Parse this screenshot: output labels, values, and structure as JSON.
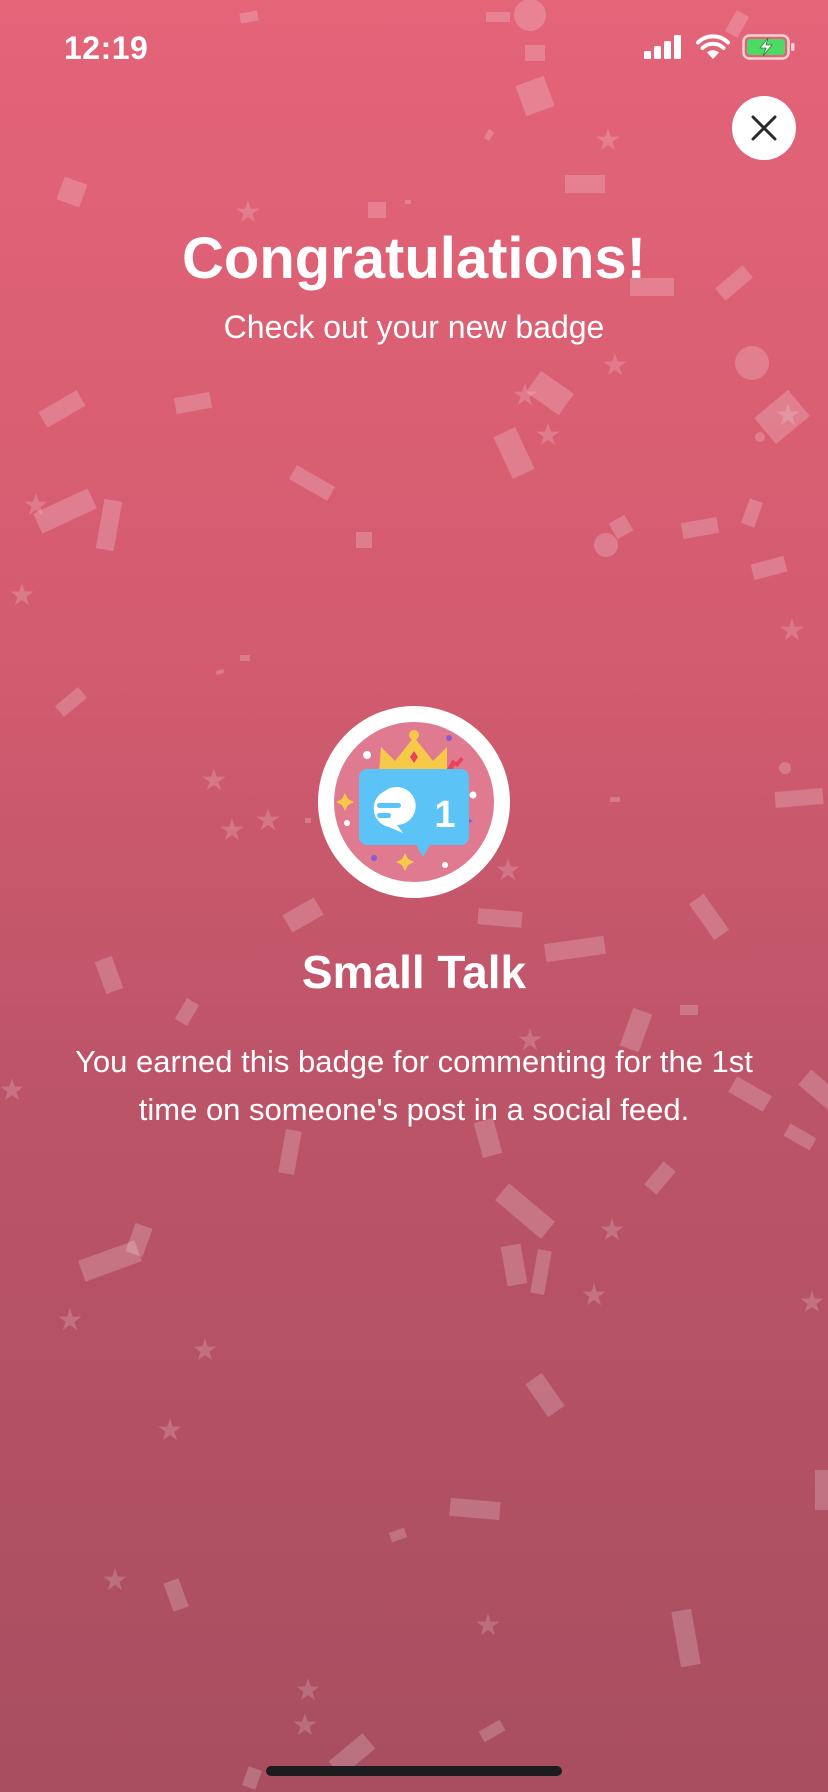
{
  "status_bar": {
    "time": "12:19"
  },
  "header": {
    "title": "Congratulations!",
    "subtitle": "Check out your new badge"
  },
  "badge": {
    "name": "Small Talk",
    "number": "1",
    "description": "You earned this badge for commenting for the 1st time on someone's post in a social feed."
  },
  "colors": {
    "background_top": "#e46478",
    "background_bottom": "#a84e60",
    "badge_inner": "#e07a90",
    "bubble": "#5bc3f5",
    "crown": "#f7c948"
  }
}
